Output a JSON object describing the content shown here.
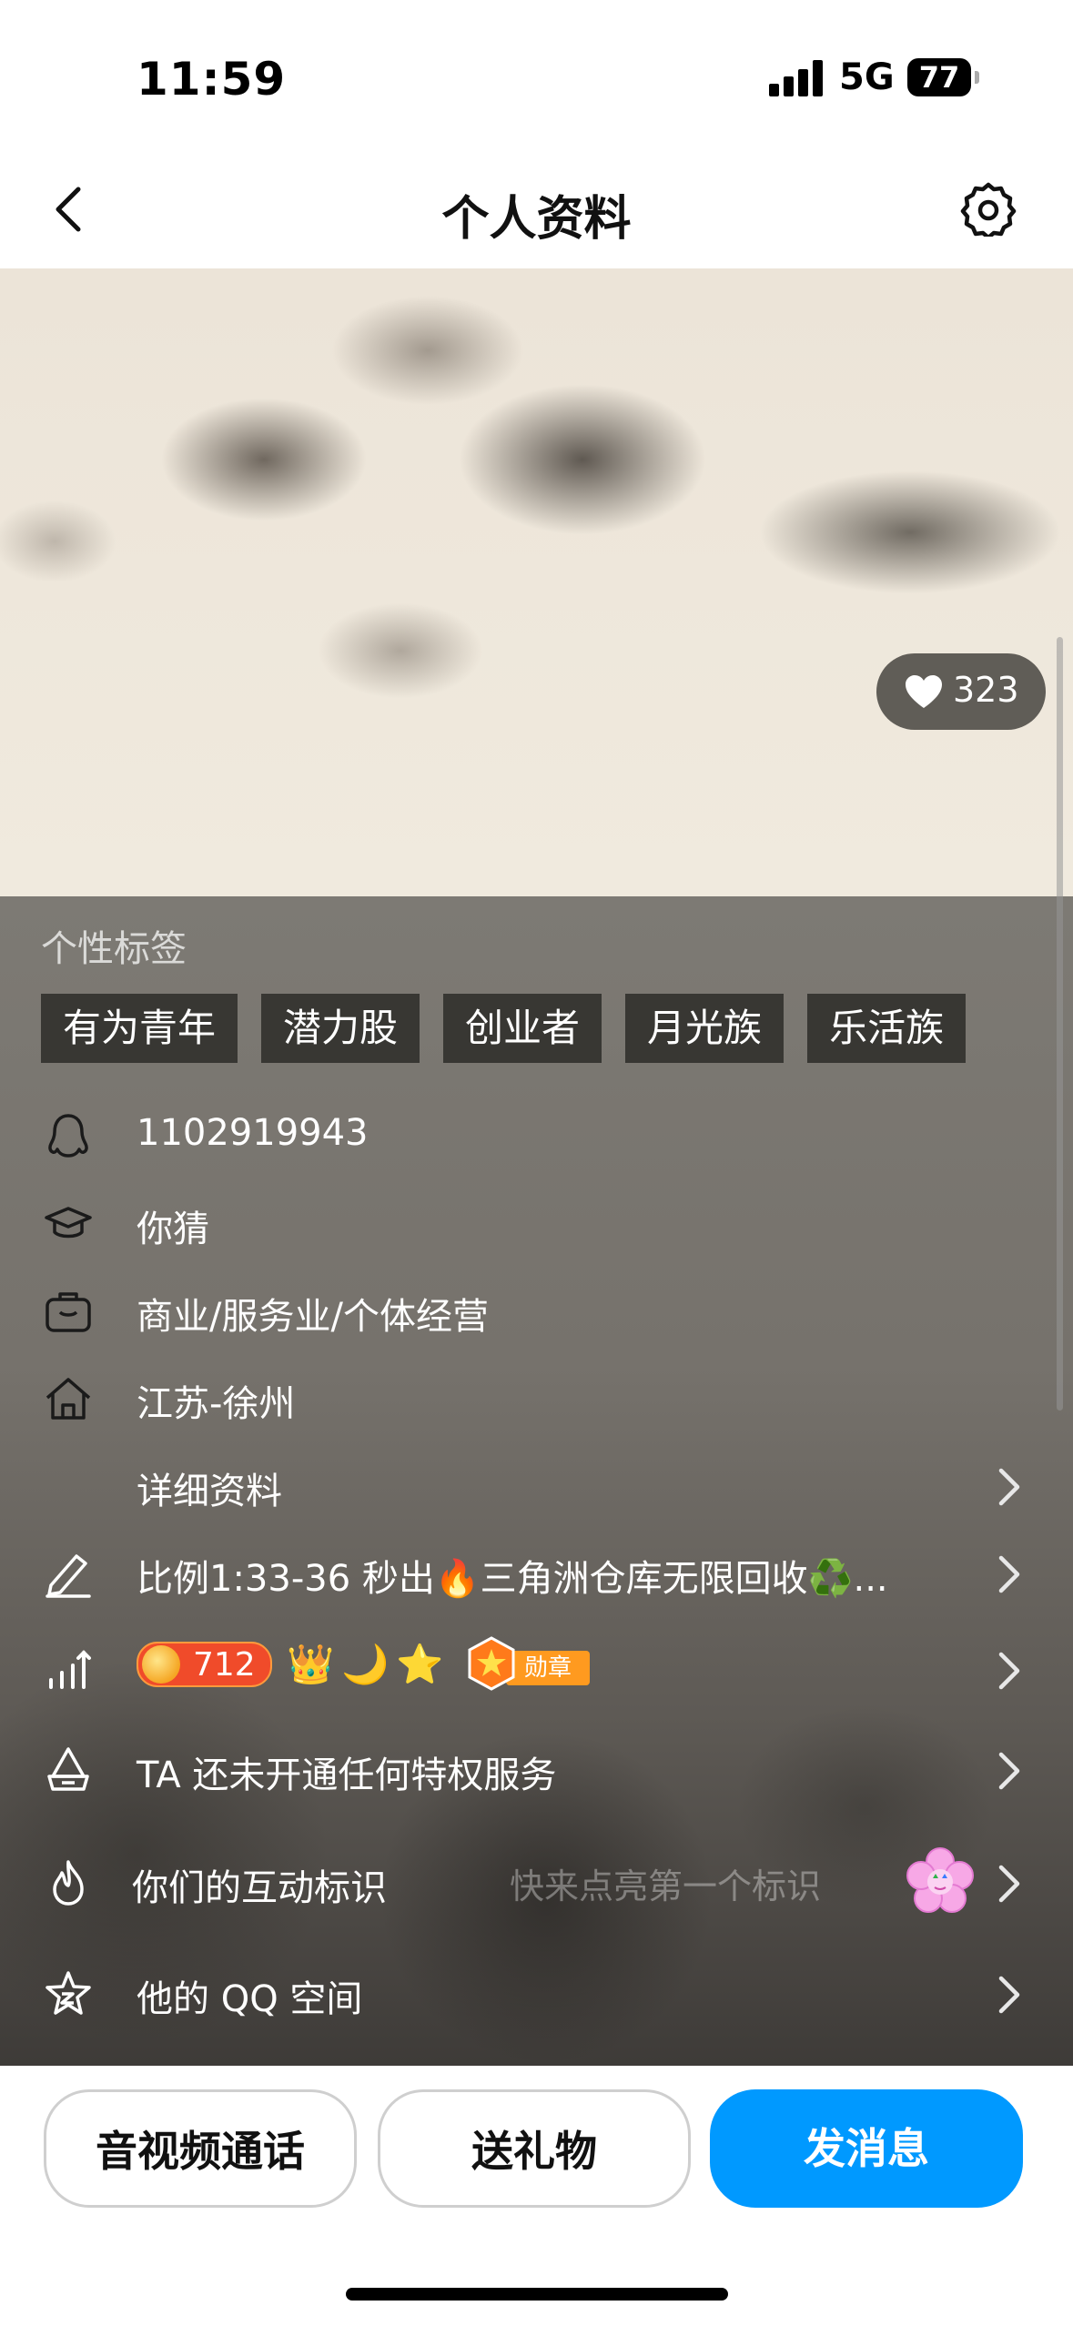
{
  "status_bar": {
    "time": "11:59",
    "network": "5G",
    "battery": "77"
  },
  "nav": {
    "title": "个人资料"
  },
  "cover": {
    "likes": "323"
  },
  "tags": {
    "label": "个性标签",
    "items": [
      "有为青年",
      "潜力股",
      "创业者",
      "月光族",
      "乐活族"
    ]
  },
  "profile": {
    "qq_number": "1102919943",
    "school": "你猜",
    "occupation": "商业/服务业/个体经营",
    "hometown": "江苏-徐州",
    "details": "详细资料",
    "signature": "比例1:33-36  秒出🔥三角洲仓库无限回收♻️...",
    "level": "712",
    "medal_label": "勋章",
    "privilege": "TA 还未开通任何特权服务",
    "interaction": "你们的互动标识",
    "interaction_hint": "快来点亮第一个标识",
    "qzone": "他的 QQ 空间"
  },
  "actions": {
    "call": "音视频通话",
    "gift": "送礼物",
    "message": "发消息"
  },
  "colors": {
    "primary": "#0099ff",
    "level_badge": "#f04b2a",
    "medal": "#ff9a1f"
  }
}
